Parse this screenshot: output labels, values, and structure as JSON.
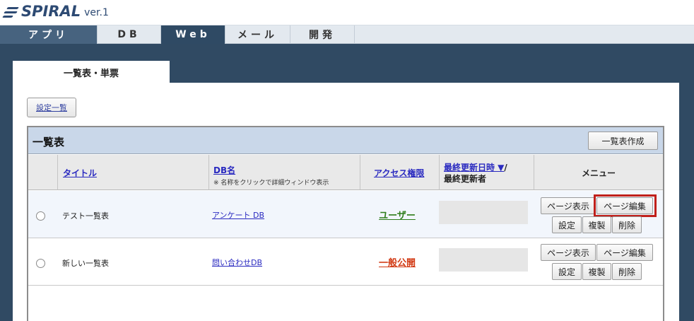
{
  "app": {
    "logo_text": "SPIRAL",
    "logo_version": "ver.1"
  },
  "nav": [
    {
      "label": "アプリ"
    },
    {
      "label": "DB"
    },
    {
      "label": "Web"
    },
    {
      "label": "メール"
    },
    {
      "label": "開発"
    }
  ],
  "tab": {
    "label": "一覧表・単票"
  },
  "toolbar": {
    "list_settings_label": "設定一覧"
  },
  "list": {
    "title": "一覧表",
    "create_button": "一覧表作成",
    "columns": {
      "title": "タイトル",
      "db_name": "DB名",
      "db_note": "※ 名称をクリックで詳細ウィンドウ表示",
      "access": "アクセス権限",
      "updated": "最終更新日時 ▼",
      "slash": "/",
      "updater": "最終更新者",
      "menu": "メニュー"
    },
    "rows": [
      {
        "title": "テスト一覧表",
        "db": "アンケート DB",
        "access": "ユーザー",
        "access_color": "#2e7d1a"
      },
      {
        "title": "新しい一覧表",
        "db": "問い合わせDB",
        "access": "一般公開",
        "access_color": "#d23a14"
      }
    ],
    "menu_buttons": {
      "view": "ページ表示",
      "edit": "ページ編集",
      "settings": "設定",
      "copy": "複製",
      "delete": "削除"
    }
  },
  "colors": {
    "nav_active": "#2f4a64",
    "header_bg": "#c9d7e9",
    "highlight": "#c0201b"
  }
}
